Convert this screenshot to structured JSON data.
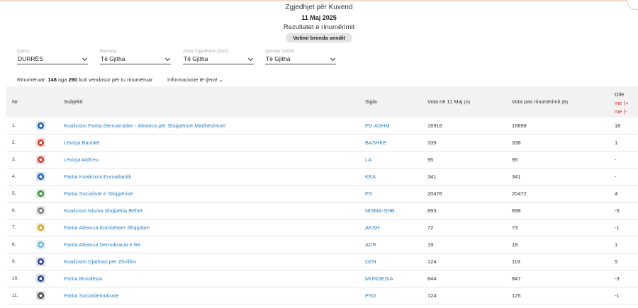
{
  "header": {
    "title": "Zgjedhjet për Kuvend",
    "date": "11 Maj 2025",
    "subtitle": "Rezultatet e rinumërimit",
    "tab_label": "Votimi brenda vendit"
  },
  "filters": [
    {
      "label": "Qarku",
      "value": "DURRËS"
    },
    {
      "label": "Bashkia",
      "value": "Të Gjitha"
    },
    {
      "label": "Zona Zgjedhore (ZAZ)",
      "value": "Të Gjitha"
    },
    {
      "label": "Qender Votimi",
      "value": "Të Gjitha"
    }
  ],
  "info": {
    "prefix": "Rinumëruar:",
    "counted": "148",
    "mid": "nga",
    "total": "290",
    "suffix": "kuti vendosur për tu rinumëruar",
    "more": "Informacione të tjera!"
  },
  "table": {
    "columns": {
      "nr": "Nr",
      "subject": "Subjekti",
      "sigla": "Sigla",
      "votes_a": "Vota në 11 Maj",
      "votes_a_tag": "(A)",
      "votes_b": "Vota pas rinumërimit",
      "votes_b_tag": "(B)",
      "diff": "Dife",
      "diff_sub1": "me (+",
      "diff_sub2": "me (-"
    },
    "rows": [
      {
        "nr": "1.",
        "subject": "Koalicioni Partia Demokratike - Aleanca për Shqipërinë Madhështore",
        "sigla": "PD-ASHM",
        "votes_a": "16916",
        "votes_b": "16898",
        "diff": "18",
        "logo": "pd-logo",
        "logo_color": "#1a5ea8"
      },
      {
        "nr": "2.",
        "subject": "Lëvizja Bashkë",
        "sigla": "BASHKE",
        "votes_a": "339",
        "votes_b": "338",
        "diff": "1",
        "logo": "bashke-logo",
        "logo_color": "#c0392b"
      },
      {
        "nr": "3.",
        "subject": "Lëvizja Atdheu",
        "sigla": "LA",
        "votes_a": "95",
        "votes_b": "95",
        "diff": "-",
        "logo": "la-logo",
        "logo_color": "#d32f2f"
      },
      {
        "nr": "4.",
        "subject": "Partia Koalicioni Euroatlantik",
        "sigla": "KEA",
        "votes_a": "341",
        "votes_b": "341",
        "diff": "-",
        "logo": "kea-logo",
        "logo_color": "#1e5fa8"
      },
      {
        "nr": "5.",
        "subject": "Partia Socialiste e Shqipërisë",
        "sigla": "PS",
        "votes_a": "20476",
        "votes_b": "20472",
        "diff": "4",
        "logo": "ps-logo",
        "logo_color": "#3a8e3a"
      },
      {
        "nr": "6.",
        "subject": "Koalicioni Nisma Shqipëria Bëhet",
        "sigla": "NISMA-SHB",
        "votes_a": "893",
        "votes_b": "898",
        "diff": "-5",
        "logo": "nisma-logo",
        "logo_color": "#7a7a7a"
      },
      {
        "nr": "7.",
        "subject": "Partia Aleanca Kombëtare Shqiptare",
        "sigla": "AKSH",
        "votes_a": "72",
        "votes_b": "73",
        "diff": "-1",
        "logo": "aksh-logo",
        "logo_color": "#c9a227"
      },
      {
        "nr": "8.",
        "subject": "Partia Aleanca Demokracia e Re",
        "sigla": "ADR",
        "votes_a": "19",
        "votes_b": "18",
        "diff": "1",
        "logo": "adr-logo",
        "logo_color": "#6fb3d9"
      },
      {
        "nr": "9.",
        "subject": "Koalicioni Djathtas për Zhvillim",
        "sigla": "DZH",
        "votes_a": "124",
        "votes_b": "119",
        "diff": "5",
        "logo": "dzh-logo",
        "logo_color": "#2d3e8f"
      },
      {
        "nr": "10.",
        "subject": "Partia Mundësia",
        "sigla": "MUNDESIA",
        "votes_a": "844",
        "votes_b": "847",
        "diff": "-3",
        "logo": "mundesia-logo",
        "logo_color": "#253f7a"
      },
      {
        "nr": "11.",
        "subject": "Partia Socialdemokrate",
        "sigla": "PSD",
        "votes_a": "124",
        "votes_b": "125",
        "diff": "-1",
        "logo": "psd-logo",
        "logo_color": "#444444"
      }
    ]
  },
  "colors": {
    "link": "#2b82c4",
    "header_bg": "#f2f2f2",
    "diff_red": "#c62828"
  }
}
